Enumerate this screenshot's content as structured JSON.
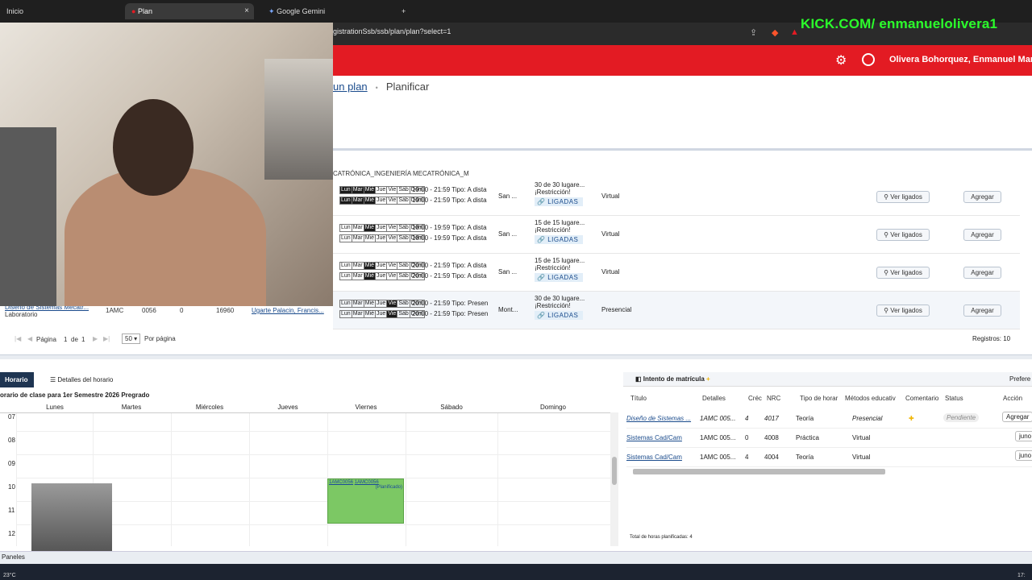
{
  "browser": {
    "tabs": [
      {
        "label": "Inicio",
        "active": false
      },
      {
        "label": "Plan",
        "active": true
      },
      {
        "label": "Google Gemini",
        "active": false
      }
    ],
    "new_tab": "+",
    "close": "×",
    "url": "gistrationSsb/ssb/plan/plan?select=1"
  },
  "overlay": {
    "stream_text": "KICK.COM/ enmanuelolivera1"
  },
  "app": {
    "username": "Olivera Bohorquez, Enmanuel Mar",
    "breadcrumb": {
      "link": "un plan",
      "sep": "•",
      "current": "Planificar"
    },
    "program": "CATRÓNICA_INGENIERÍA MECATRÓNICA_M"
  },
  "sections": [
    {
      "days_sets": [
        [
          "Lun",
          "Mar",
          "Mié",
          "Jue",
          "Vie",
          "Sáb",
          "Dom"
        ],
        [
          "Lun",
          "Mar",
          "Mié",
          "Jue",
          "Vie",
          "Sáb",
          "Dom"
        ]
      ],
      "on": [
        [
          0,
          1,
          2
        ],
        [
          0,
          1,
          2
        ]
      ],
      "times": [
        "19:00 - 21:59 Tipo: A dista",
        "19:00 - 21:59 Tipo: A dista"
      ],
      "campus": "San ...",
      "seats": "30 de 30 lugare...",
      "restriction": "¡Restricción!",
      "ligadas": "LIGADAS",
      "mode": "Virtual",
      "btn_ver": "Ver ligados",
      "btn_add": "Agregar"
    },
    {
      "days_sets": [
        [
          "Lun",
          "Mar",
          "Mié",
          "Jue",
          "Vie",
          "Sáb",
          "Dom"
        ],
        [
          "Lun",
          "Mar",
          "Mié",
          "Jue",
          "Vie",
          "Sáb",
          "Dom"
        ]
      ],
      "on": [
        [
          2
        ],
        []
      ],
      "times": [
        "18:00 - 19:59 Tipo: A dista",
        "18:00 - 19:59 Tipo: A dista"
      ],
      "campus": "San ...",
      "seats": "15 de 15 lugare...",
      "restriction": "¡Restricción!",
      "ligadas": "LIGADAS",
      "mode": "Virtual",
      "btn_ver": "Ver ligados",
      "btn_add": "Agregar"
    },
    {
      "days_sets": [
        [
          "Lun",
          "Mar",
          "Mié",
          "Jue",
          "Vie",
          "Sáb",
          "Dom"
        ],
        [
          "Lun",
          "Mar",
          "Mié",
          "Jue",
          "Vie",
          "Sáb",
          "Dom"
        ]
      ],
      "on": [
        [
          2
        ],
        [
          2
        ]
      ],
      "times": [
        "20:00 - 21:59 Tipo: A dista",
        "20:00 - 21:59 Tipo: A dista"
      ],
      "campus": "San ...",
      "seats": "15 de 15 lugare...",
      "restriction": "¡Restricción!",
      "ligadas": "LIGADAS",
      "mode": "Virtual",
      "btn_ver": "Ver ligados",
      "btn_add": "Agregar"
    },
    {
      "days_sets": [
        [
          "Lun",
          "Mar",
          "Mié",
          "Jue",
          "Vie",
          "Sáb",
          "Dom"
        ],
        [
          "Lun",
          "Mar",
          "Mié",
          "Jue",
          "Vie",
          "Sáb",
          "Dom"
        ]
      ],
      "on": [
        [
          4
        ],
        [
          4
        ]
      ],
      "times": [
        "20:00 - 21:59 Tipo: Presen",
        "20:00 - 21:59 Tipo: Presen"
      ],
      "campus": "Mont...",
      "seats": "30 de 30 lugare...",
      "restriction": "¡Restricción!",
      "ligadas": "LIGADAS",
      "mode": "Presencial",
      "btn_ver": "Ver ligados",
      "btn_add": "Agregar"
    }
  ],
  "row4_left": {
    "title": "Diseño de Sistemas Mecatr...",
    "subtitle": "Laboratorio",
    "subject": "1AMC",
    "course": "0056",
    "credits": "0",
    "nrc": "16960",
    "instructor": "Ugarte Palacin, Francis..."
  },
  "pager": {
    "page_label": "Página",
    "page": "1",
    "of": "de",
    "total": "1",
    "per_page": "50",
    "per_page_label": "Por página",
    "records": "Registros: 10"
  },
  "schedule": {
    "tabs": [
      "Horario",
      "Detalles del horario"
    ],
    "title": "orario de clase para 1er Semestre 2026 Pregrado",
    "days": [
      "Lunes",
      "Martes",
      "Miércoles",
      "Jueves",
      "Viernes",
      "Sábado",
      "Domingo"
    ],
    "hours": [
      "07",
      "08",
      "09",
      "10",
      "11",
      "12"
    ],
    "event": {
      "line1": "1AMC0056",
      "line2": "1AMC0056",
      "note": "(Planificado)"
    }
  },
  "attempt": {
    "title": "Intento de matrícula",
    "prefs": "Prefere",
    "columns": [
      "Título",
      "Detalles",
      "Créc",
      "NRC",
      "Tipo de horar",
      "Métodos educativ",
      "Comentario",
      "Status",
      "Acción"
    ],
    "rows": [
      {
        "title": "Diseño de Sistemas ...",
        "details": "1AMC 005...",
        "credits": "4",
        "nrc": "4017",
        "type": "Teoría",
        "method": "Presencial",
        "status": "Pendiente",
        "action": "Agregar"
      },
      {
        "title": "Sistemas Cad/Cam",
        "details": "1AMC 005...",
        "credits": "0",
        "nrc": "4008",
        "type": "Práctica",
        "method": "Virtual",
        "status": "",
        "action": "juno"
      },
      {
        "title": "Sistemas Cad/Cam",
        "details": "1AMC 005...",
        "credits": "4",
        "nrc": "4004",
        "type": "Teoría",
        "method": "Virtual",
        "status": "",
        "action": "juno"
      }
    ],
    "totals": "Total de horas planificadas: 4"
  },
  "footer": {
    "panels": "Paneles",
    "temperature": "23°C",
    "clock": "17:"
  },
  "colors": {
    "brand_red": "#e31b23",
    "event_green": "#7cc864",
    "stream_green": "#2bff2b"
  }
}
